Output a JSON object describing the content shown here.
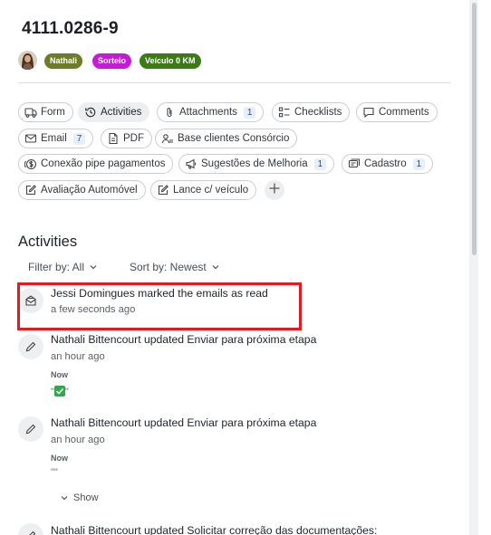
{
  "record": {
    "title": "4111.0286-9",
    "tags": [
      {
        "label": "Nathali",
        "color": "#6e7c2a"
      },
      {
        "label": "Sorteio",
        "color": "#c51bd7"
      },
      {
        "label": "Veículo 0 KM",
        "color": "#3b7a16"
      }
    ]
  },
  "tabs": [
    {
      "label": "Form",
      "icon": "truck-icon"
    },
    {
      "label": "Activities",
      "icon": "history-icon",
      "active": true
    },
    {
      "label": "Attachments",
      "icon": "paperclip-icon",
      "count": "1"
    },
    {
      "label": "Checklists",
      "icon": "checklist-icon"
    },
    {
      "label": "Comments",
      "icon": "comment-icon"
    },
    {
      "label": "Email",
      "icon": "mail-icon",
      "count": "7"
    },
    {
      "label": "PDF",
      "icon": "pdf-icon"
    },
    {
      "label": "Base clientes Consórcio",
      "icon": "users-icon"
    },
    {
      "label": "Conexão pipe pagamentos",
      "icon": "dollar-icon"
    },
    {
      "label": "Sugestões de Melhoria",
      "icon": "megaphone-icon",
      "count": "1"
    },
    {
      "label": "Cadastro",
      "icon": "cards-icon",
      "count": "1"
    },
    {
      "label": "Avaliação Automóvel",
      "icon": "edit-icon"
    },
    {
      "label": "Lance c/ veículo",
      "icon": "edit-icon"
    }
  ],
  "activities": {
    "heading": "Activities",
    "filter_label": "Filter by: All",
    "sort_label": "Sort by: Newest",
    "items": [
      {
        "title": "Jessi Domingues marked the emails as read",
        "time": "a few seconds ago",
        "icon": "mail-read-icon"
      },
      {
        "title": "Nathali Bittencourt updated Enviar para próxima etapa",
        "time": "an hour ago",
        "label": "Now",
        "value_prefix": "\"",
        "value_suffix": "\"",
        "icon": "pencil-icon"
      },
      {
        "title": "Nathali Bittencourt updated Enviar para próxima etapa",
        "time": "an hour ago",
        "label": "Now",
        "value": "\"\"",
        "icon": "pencil-icon"
      },
      {
        "title": "Nathali Bittencourt updated Solicitar correção das documentações:",
        "icon": "pencil-icon"
      }
    ],
    "show_label": "Show"
  }
}
